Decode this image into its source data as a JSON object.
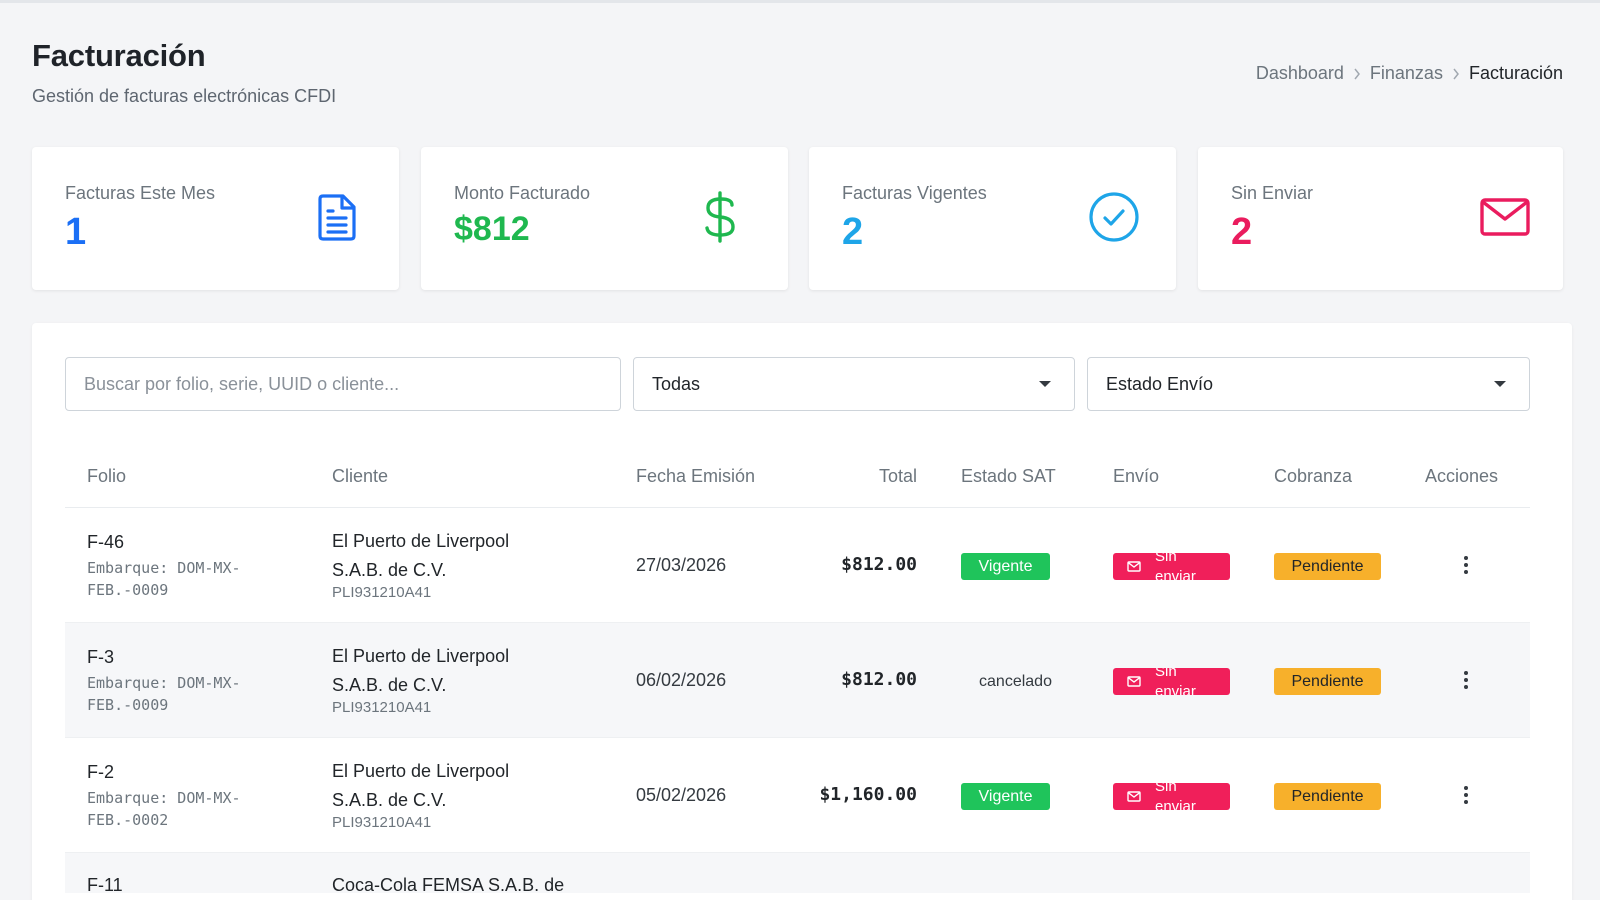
{
  "header": {
    "title": "Facturación",
    "subtitle": "Gestión de facturas electrónicas CFDI"
  },
  "breadcrumb": [
    "Dashboard",
    "Finanzas",
    "Facturación"
  ],
  "stats": [
    {
      "label": "Facturas Este Mes",
      "value": "1",
      "icon": "document-icon",
      "color": "#1b6ff5"
    },
    {
      "label": "Monto Facturado",
      "value": "$812",
      "icon": "dollar-icon",
      "color": "#1fb84f"
    },
    {
      "label": "Facturas Vigentes",
      "value": "2",
      "icon": "check-circle-icon",
      "color": "#1ea5e8"
    },
    {
      "label": "Sin Enviar",
      "value": "2",
      "icon": "envelope-icon",
      "color": "#ea1c5e"
    }
  ],
  "filters": {
    "search_placeholder": "Buscar por folio, serie, UUID o cliente...",
    "search_value": "",
    "estado_select": "Todas",
    "envio_select": "Estado Envío"
  },
  "table": {
    "headers": [
      "Folio",
      "Cliente",
      "Fecha Emisión",
      "Total",
      "Estado SAT",
      "Envío",
      "Cobranza",
      "Acciones"
    ],
    "rows": [
      {
        "folio": "F-46",
        "embarque": "Embarque: DOM-MX-FEB.-0009",
        "cliente": "El Puerto de Liverpool S.A.B. de C.V.",
        "rfc": "PLI931210A41",
        "fecha": "27/03/2026",
        "total": "$812.00",
        "estado_sat": "Vigente",
        "envio": "Sin enviar",
        "cobranza": "Pendiente"
      },
      {
        "folio": "F-3",
        "embarque": "Embarque: DOM-MX-FEB.-0009",
        "cliente": "El Puerto de Liverpool S.A.B. de C.V.",
        "rfc": "PLI931210A41",
        "fecha": "06/02/2026",
        "total": "$812.00",
        "estado_sat": "cancelado",
        "envio": "Sin enviar",
        "cobranza": "Pendiente"
      },
      {
        "folio": "F-2",
        "embarque": "Embarque: DOM-MX-FEB.-0002",
        "cliente": "El Puerto de Liverpool S.A.B. de C.V.",
        "rfc": "PLI931210A41",
        "fecha": "05/02/2026",
        "total": "$1,160.00",
        "estado_sat": "Vigente",
        "envio": "Sin enviar",
        "cobranza": "Pendiente"
      }
    ],
    "partial_row": {
      "folio": "F-11",
      "cliente": "Coca-Cola FEMSA S.A.B. de"
    }
  }
}
